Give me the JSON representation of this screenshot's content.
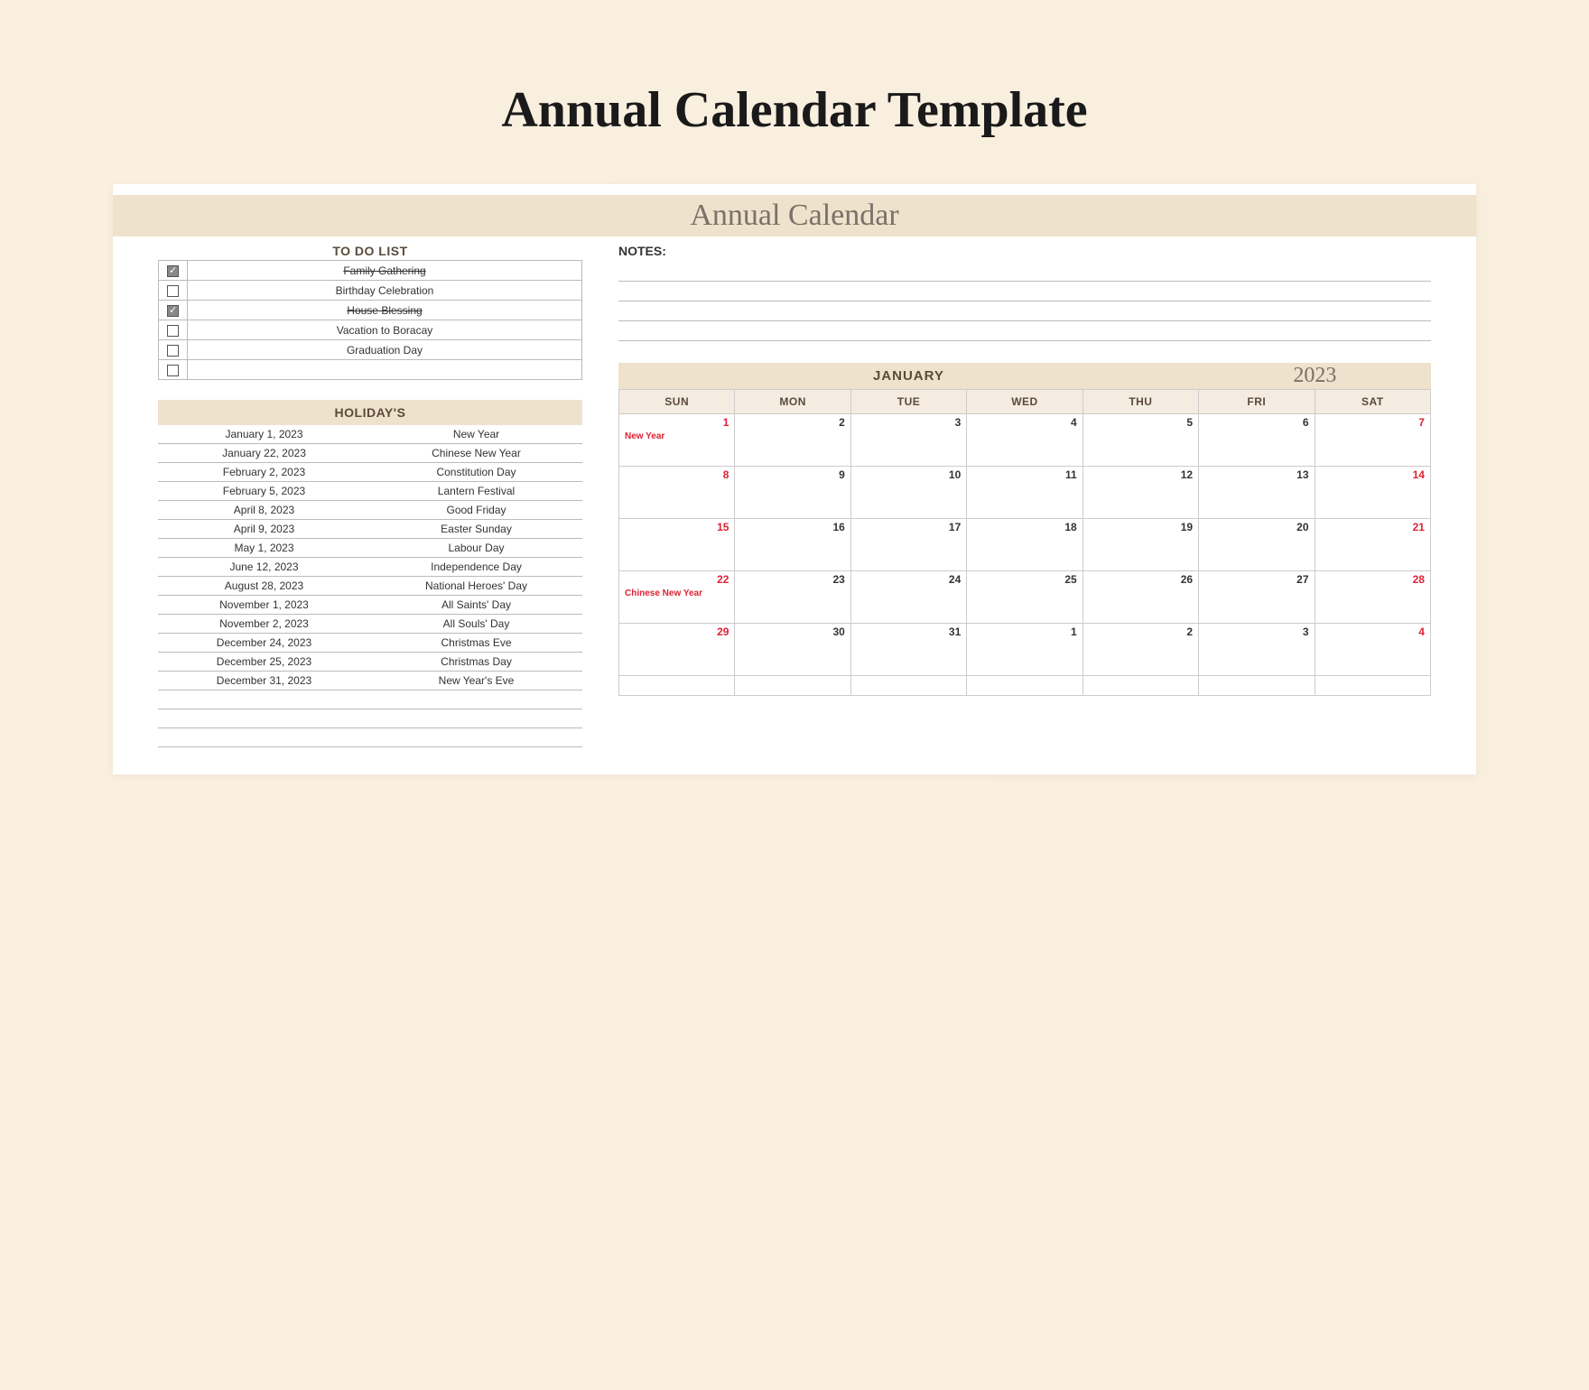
{
  "pageTitle": "Annual Calendar Template",
  "bannerTitle": "Annual Calendar",
  "todoHeader": "TO DO LIST",
  "todos": [
    {
      "done": true,
      "label": "Family Gathering"
    },
    {
      "done": false,
      "label": "Birthday Celebration"
    },
    {
      "done": true,
      "label": "House Blessing"
    },
    {
      "done": false,
      "label": "Vacation to Boracay"
    },
    {
      "done": false,
      "label": "Graduation Day"
    },
    {
      "done": false,
      "label": ""
    }
  ],
  "holidaysHeader": "HOLIDAY'S",
  "holidays": [
    {
      "date": "January 1, 2023",
      "name": "New Year"
    },
    {
      "date": "January 22, 2023",
      "name": "Chinese New Year"
    },
    {
      "date": "February 2, 2023",
      "name": "Constitution Day"
    },
    {
      "date": "February 5, 2023",
      "name": "Lantern Festival"
    },
    {
      "date": "April 8, 2023",
      "name": "Good Friday"
    },
    {
      "date": "April 9, 2023",
      "name": "Easter Sunday"
    },
    {
      "date": "May 1, 2023",
      "name": "Labour Day"
    },
    {
      "date": "June 12, 2023",
      "name": "Independence Day"
    },
    {
      "date": "August 28, 2023",
      "name": "National Heroes' Day"
    },
    {
      "date": "November 1, 2023",
      "name": "All Saints' Day"
    },
    {
      "date": "November 2, 2023",
      "name": "All Souls' Day"
    },
    {
      "date": "December 24, 2023",
      "name": "Christmas Eve"
    },
    {
      "date": "December 25, 2023",
      "name": "Christmas Day"
    },
    {
      "date": "December 31, 2023",
      "name": "New Year's Eve"
    }
  ],
  "notesLabel": "NOTES:",
  "noteLines": 4,
  "calendar": {
    "month": "JANUARY",
    "year": "2023",
    "dow": [
      "SUN",
      "MON",
      "TUE",
      "WED",
      "THU",
      "FRI",
      "SAT"
    ],
    "weeks": [
      [
        {
          "n": "1",
          "w": true,
          "e": "New Year"
        },
        {
          "n": "2"
        },
        {
          "n": "3"
        },
        {
          "n": "4"
        },
        {
          "n": "5"
        },
        {
          "n": "6"
        },
        {
          "n": "7",
          "w": true
        }
      ],
      [
        {
          "n": "8",
          "w": true
        },
        {
          "n": "9"
        },
        {
          "n": "10"
        },
        {
          "n": "11"
        },
        {
          "n": "12"
        },
        {
          "n": "13"
        },
        {
          "n": "14",
          "w": true
        }
      ],
      [
        {
          "n": "15",
          "w": true
        },
        {
          "n": "16"
        },
        {
          "n": "17"
        },
        {
          "n": "18"
        },
        {
          "n": "19"
        },
        {
          "n": "20"
        },
        {
          "n": "21",
          "w": true
        }
      ],
      [
        {
          "n": "22",
          "w": true,
          "e": "Chinese New Year"
        },
        {
          "n": "23"
        },
        {
          "n": "24"
        },
        {
          "n": "25"
        },
        {
          "n": "26"
        },
        {
          "n": "27"
        },
        {
          "n": "28",
          "w": true
        }
      ],
      [
        {
          "n": "29",
          "w": true
        },
        {
          "n": "30"
        },
        {
          "n": "31"
        },
        {
          "n": "1"
        },
        {
          "n": "2"
        },
        {
          "n": "3"
        },
        {
          "n": "4",
          "w": true
        }
      ],
      [
        {
          "n": ""
        },
        {
          "n": ""
        },
        {
          "n": ""
        },
        {
          "n": ""
        },
        {
          "n": ""
        },
        {
          "n": ""
        },
        {
          "n": ""
        }
      ]
    ]
  }
}
